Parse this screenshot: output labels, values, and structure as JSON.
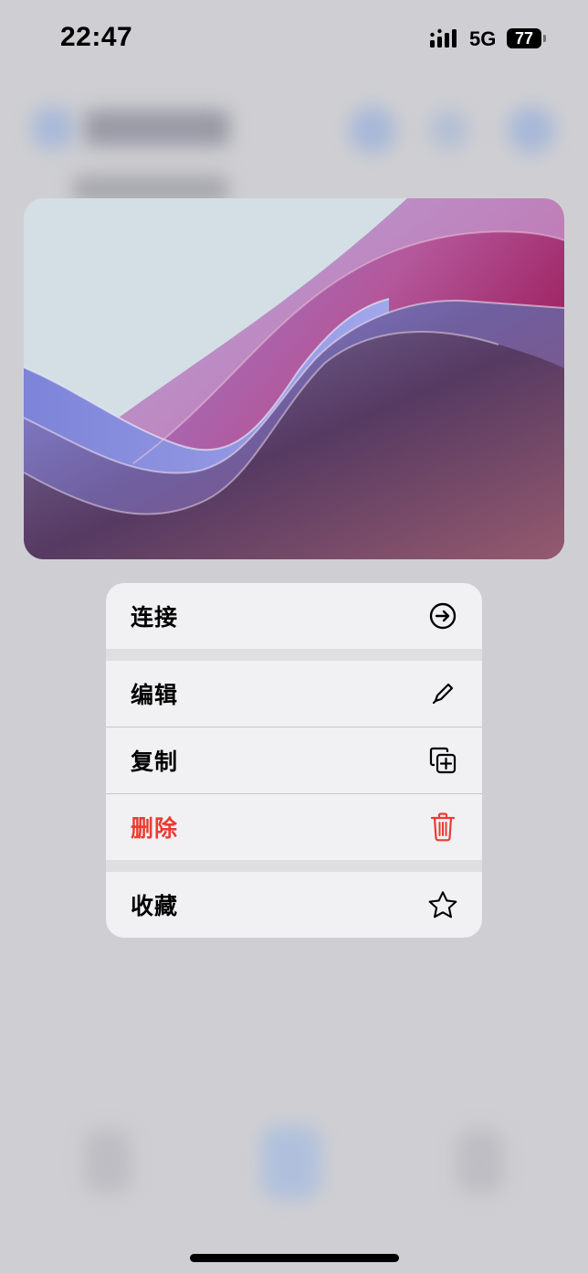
{
  "status_bar": {
    "time": "22:47",
    "network": "5G",
    "battery": "77",
    "signal_icon": "cellular-signal-icon"
  },
  "preview": {
    "image": "abstract-wave-wallpaper",
    "colors": [
      "#d3dfe5",
      "#7f85d8",
      "#b85b97",
      "#8e0d45",
      "#e0649a"
    ]
  },
  "menu": {
    "items": [
      {
        "label": "连接",
        "icon": "arrow-circle-right-icon",
        "destructive": false
      },
      {
        "label": "编辑",
        "icon": "pencil-icon",
        "destructive": false
      },
      {
        "label": "复制",
        "icon": "duplicate-plus-icon",
        "destructive": false
      },
      {
        "label": "删除",
        "icon": "trash-icon",
        "destructive": true
      },
      {
        "label": "收藏",
        "icon": "star-icon",
        "destructive": false
      }
    ],
    "destructive_color": "#eb3b32"
  }
}
